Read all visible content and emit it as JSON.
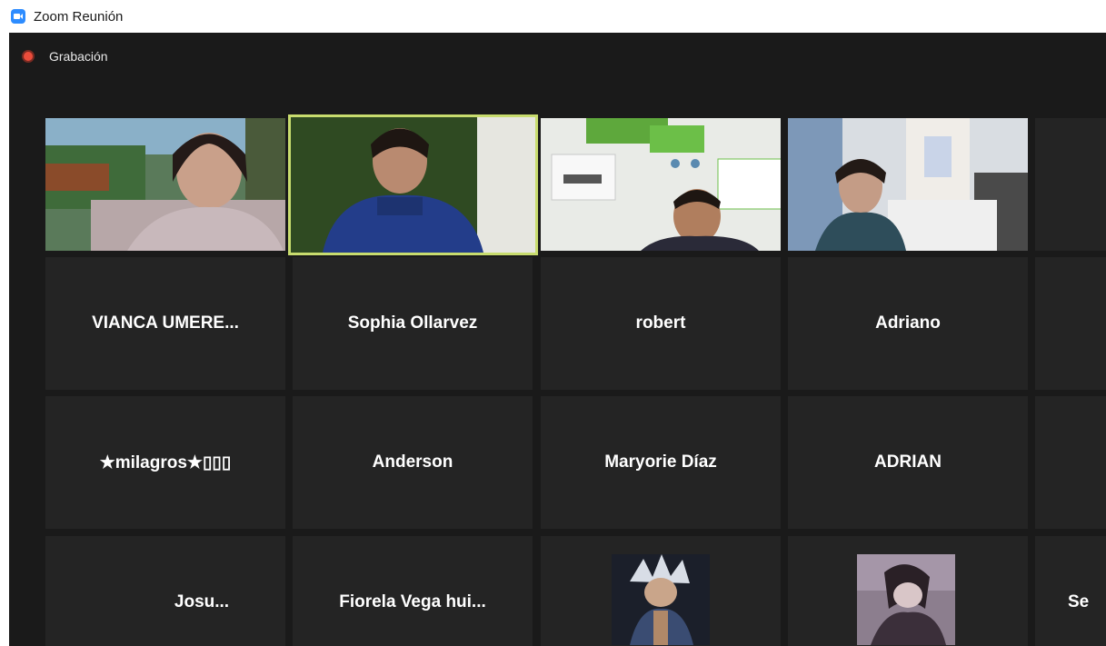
{
  "window": {
    "title": "Zoom Reunión"
  },
  "recording": {
    "label": "Grabación"
  },
  "icons": {
    "app": "zoom-camera-icon",
    "recording": "recording-dot-icon"
  },
  "colors": {
    "meeting_bg": "#1a1a1a",
    "tile_bg": "#242424",
    "active_speaker_border": "#c8dc6e",
    "recording_red": "#ea4c3b",
    "zoom_blue": "#2d8cff"
  },
  "participants": {
    "video_row": [
      {
        "description": "video-feed"
      },
      {
        "description": "video-feed",
        "active_speaker": true
      },
      {
        "description": "video-feed"
      },
      {
        "description": "video-feed"
      }
    ],
    "row2": [
      "VIANCA  UMERE...",
      "Sophia Ollarvez",
      "robert",
      "Adriano"
    ],
    "row3": [
      "★milagros★▯▯▯",
      "Anderson",
      "Maryorie Díaz",
      "ADRIAN"
    ],
    "row4": [
      "Josu...",
      "Fiorela  Vega  hui...",
      "",
      ""
    ],
    "row4_partial_right": "Se"
  }
}
